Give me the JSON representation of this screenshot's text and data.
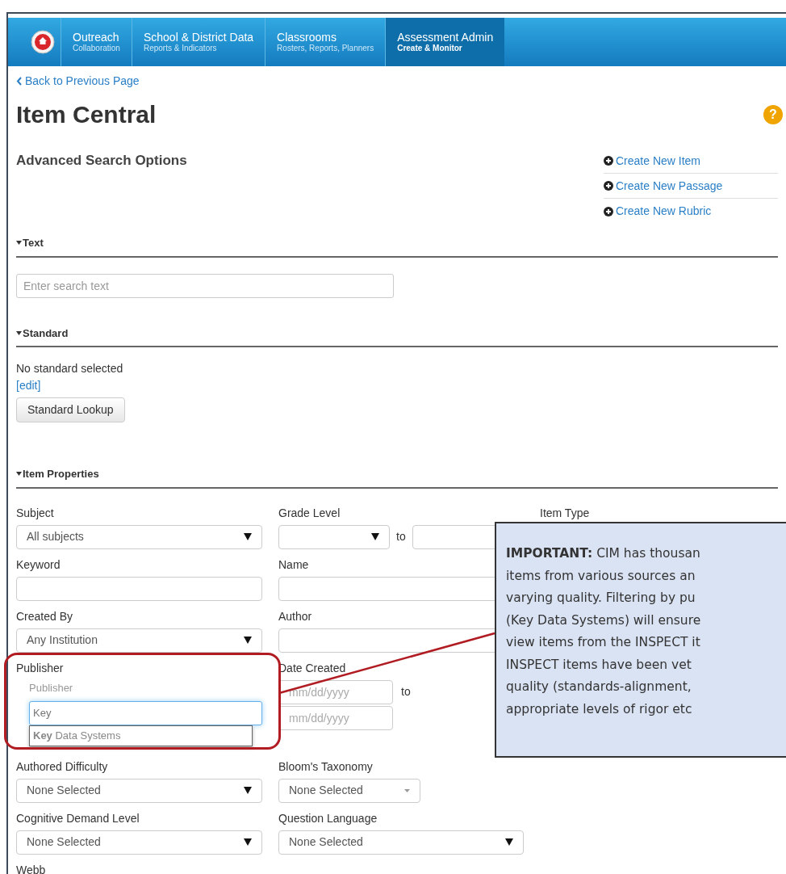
{
  "nav": {
    "items": [
      {
        "title": "Outreach",
        "subtitle": "Collaboration",
        "selected": false
      },
      {
        "title": "School & District Data",
        "subtitle": "Reports & Indicators",
        "selected": false
      },
      {
        "title": "Classrooms",
        "subtitle": "Rosters, Reports, Planners",
        "selected": false
      },
      {
        "title": "Assessment Admin",
        "subtitle": "Create & Monitor",
        "selected": true
      }
    ]
  },
  "back_link": "Back to Previous Page",
  "page_title": "Item Central",
  "help": "?",
  "subtitle": "Advanced Search Options",
  "actions": [
    "Create New Item",
    "Create New Passage",
    "Create New Rubric"
  ],
  "text_section": {
    "title": "Text",
    "placeholder": "Enter search text"
  },
  "standard_section": {
    "title": "Standard",
    "status": "No standard selected",
    "edit_link": "[edit]",
    "button": "Standard Lookup"
  },
  "properties_section": {
    "title": "Item Properties",
    "fields": [
      {
        "kind": "select",
        "label": "Subject",
        "value": "All subjects"
      },
      {
        "kind": "range",
        "label": "Grade Level",
        "separator": "to"
      },
      {
        "kind": "text",
        "label": "Item Type"
      },
      {
        "kind": "text",
        "label": "Keyword"
      },
      {
        "kind": "text",
        "label": "Name"
      },
      {
        "kind": "blank"
      },
      {
        "kind": "select",
        "label": "Created By",
        "value": "Any Institution"
      },
      {
        "kind": "text",
        "label": "Author"
      },
      {
        "kind": "blank"
      },
      {
        "kind": "typeahead",
        "label": "Publisher",
        "hint": "Publisher",
        "value": "Key",
        "suggestion": "**Key** Data Systems"
      },
      {
        "kind": "dates",
        "label": "Date Created",
        "placeholder": "mm/dd/yyyy",
        "separator": "to",
        "placeholder_2": "mm/dd/yyyy"
      },
      {
        "kind": "blank"
      },
      {
        "kind": "select",
        "label": "Authored Difficulty",
        "value": "None Selected"
      },
      {
        "kind": "small-select",
        "label": "Bloom's Taxonomy",
        "value": "None Selected"
      },
      {
        "kind": "blank"
      },
      {
        "kind": "select",
        "label": "Cognitive Demand Level",
        "value": "None Selected"
      },
      {
        "kind": "select",
        "label": "Question Language",
        "value": "None Selected"
      },
      {
        "kind": "blank"
      },
      {
        "kind": "select",
        "label": "Webb"
      }
    ]
  },
  "callout": {
    "lines": [
      "**IMPORTANT:** CIM has thousan",
      "items from various sources an",
      "varying quality. Filtering by pu",
      "(Key Data Systems) will ensure",
      "view items from the INSPECT it",
      "INSPECT items have been vet",
      "quality (standards-alignment,",
      "appropriate levels of rigor etc"
    ]
  }
}
